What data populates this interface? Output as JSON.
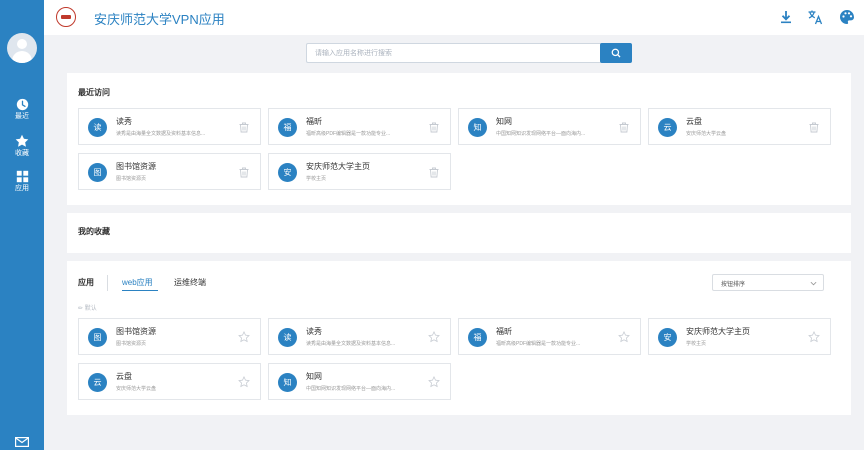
{
  "sidebar": {
    "nav": [
      {
        "label": "最近",
        "icon": "clock-icon"
      },
      {
        "label": "收藏",
        "icon": "star-icon"
      },
      {
        "label": "应用",
        "icon": "grid-icon"
      }
    ]
  },
  "header": {
    "title": "安庆师范大学VPN应用"
  },
  "search": {
    "placeholder": "请输入应用名称进行搜索"
  },
  "recent": {
    "title": "最近访问",
    "apps": [
      {
        "glyph": "读",
        "name": "读秀",
        "desc": "读秀是由海量全文数据及资料基本信息..."
      },
      {
        "glyph": "福",
        "name": "福昕",
        "desc": "福昕高级PDF编辑器是一款功能专业..."
      },
      {
        "glyph": "知",
        "name": "知网",
        "desc": "中国知网知识发现网络平台—面向海内..."
      },
      {
        "glyph": "云",
        "name": "云盘",
        "desc": "安庆师范大学云盘"
      },
      {
        "glyph": "图",
        "name": "图书馆资源",
        "desc": "图书馆资源页"
      },
      {
        "glyph": "安",
        "name": "安庆师范大学主页",
        "desc": "学校主页"
      }
    ]
  },
  "favorites": {
    "title": "我的收藏"
  },
  "apps": {
    "title": "应用",
    "tabs": [
      "web应用",
      "运维终端"
    ],
    "sort": "按钮排序",
    "group": "默认",
    "list": [
      {
        "glyph": "图",
        "name": "图书馆资源",
        "desc": "图书馆资源页"
      },
      {
        "glyph": "读",
        "name": "读秀",
        "desc": "读秀是由海量全文数据及资料基本信息..."
      },
      {
        "glyph": "福",
        "name": "福昕",
        "desc": "福昕高级PDF编辑器是一款功能专业..."
      },
      {
        "glyph": "安",
        "name": "安庆师范大学主页",
        "desc": "学校主页"
      },
      {
        "glyph": "云",
        "name": "云盘",
        "desc": "安庆师范大学云盘"
      },
      {
        "glyph": "知",
        "name": "知网",
        "desc": "中国知网知识发现网络平台—面向海内..."
      }
    ]
  },
  "colors": {
    "brand": "#2b82c2",
    "background": "#f1f2f5"
  }
}
